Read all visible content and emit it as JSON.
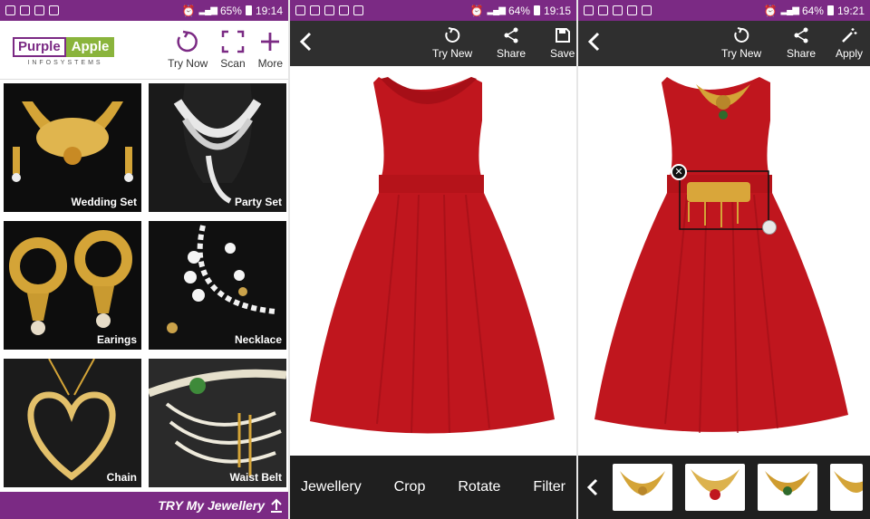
{
  "screens": [
    {
      "status": {
        "battery": "65%",
        "time": "19:14"
      },
      "logo": {
        "word1": "Purple",
        "word2": "Apple",
        "sub": "INFOSYSTEMS"
      },
      "actions": [
        {
          "label": "Try Now",
          "icon": "refresh-icon"
        },
        {
          "label": "Scan",
          "icon": "scan-icon"
        },
        {
          "label": "More",
          "icon": "plus-icon"
        }
      ],
      "categories": [
        {
          "label": "Wedding Set"
        },
        {
          "label": "Party Set"
        },
        {
          "label": "Earings"
        },
        {
          "label": "Necklace"
        },
        {
          "label": "Chain"
        },
        {
          "label": "Waist Belt"
        }
      ],
      "footer": "TRY My Jewellery"
    },
    {
      "status": {
        "battery": "64%",
        "time": "19:15"
      },
      "actions": [
        {
          "label": "Try New",
          "icon": "refresh-icon"
        },
        {
          "label": "Share",
          "icon": "share-icon"
        },
        {
          "label": "Save",
          "icon": "save-icon"
        }
      ],
      "menu": [
        "Jewellery",
        "Crop",
        "Rotate",
        "Filter"
      ]
    },
    {
      "status": {
        "battery": "64%",
        "time": "19:21"
      },
      "actions": [
        {
          "label": "Try New",
          "icon": "refresh-icon"
        },
        {
          "label": "Share",
          "icon": "share-icon"
        },
        {
          "label": "Apply",
          "icon": "magic-wand-icon"
        }
      ]
    }
  ],
  "colors": {
    "brand_purple": "#7b2a84",
    "brand_green": "#8ab43c",
    "dress_red": "#c0161e",
    "gold": "#d4a437",
    "toolbar": "#2f2f2f"
  }
}
